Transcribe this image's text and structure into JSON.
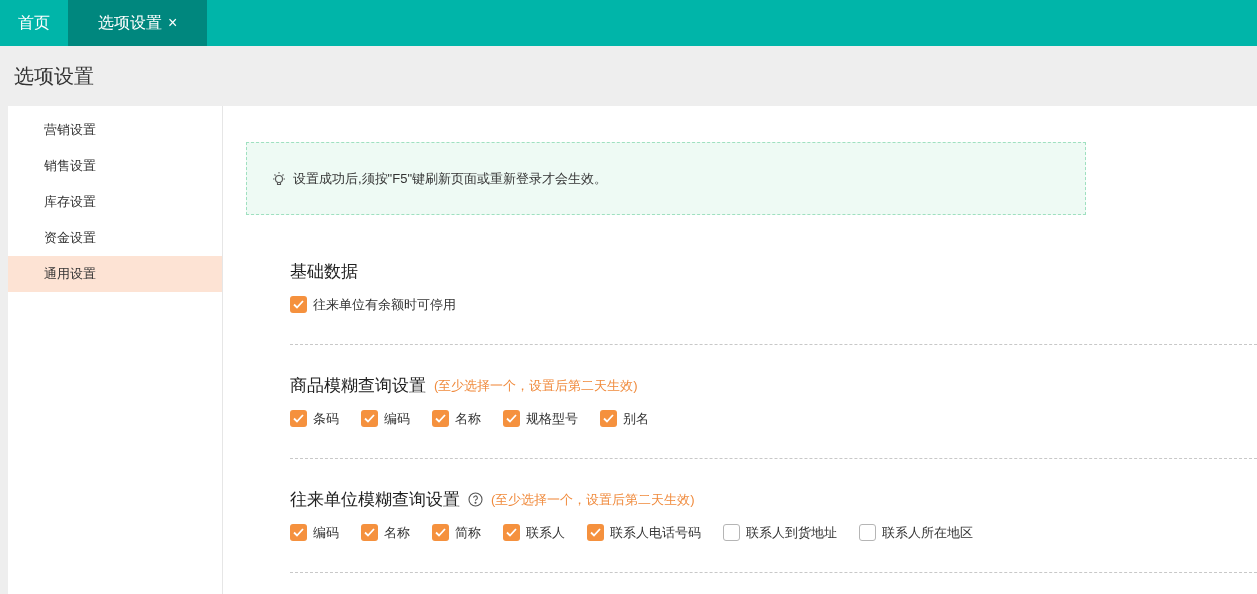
{
  "tabs": [
    {
      "label": "首页",
      "selected": false
    },
    {
      "label": "选项设置",
      "selected": true,
      "close_glyph": "×"
    }
  ],
  "page_title": "选项设置",
  "sidebar": {
    "items": [
      {
        "label": "营销设置",
        "selected": false
      },
      {
        "label": "销售设置",
        "selected": false
      },
      {
        "label": "库存设置",
        "selected": false
      },
      {
        "label": "资金设置",
        "selected": false
      },
      {
        "label": "通用设置",
        "selected": true
      }
    ]
  },
  "notice": "设置成功后,须按\"F5\"键刷新页面或重新登录才会生效。",
  "sections": [
    {
      "title": "基础数据",
      "options": [
        {
          "label": "往来单位有余额时可停用",
          "checked": true
        }
      ]
    },
    {
      "title": "商品模糊查询设置",
      "hint": "(至少选择一个，设置后第二天生效)",
      "options": [
        {
          "label": "条码",
          "checked": true
        },
        {
          "label": "编码",
          "checked": true
        },
        {
          "label": "名称",
          "checked": true
        },
        {
          "label": "规格型号",
          "checked": true
        },
        {
          "label": "别名",
          "checked": true
        }
      ]
    },
    {
      "title": "往来单位模糊查询设置",
      "help": true,
      "hint": "(至少选择一个，设置后第二天生效)",
      "options": [
        {
          "label": "编码",
          "checked": true
        },
        {
          "label": "名称",
          "checked": true
        },
        {
          "label": "简称",
          "checked": true
        },
        {
          "label": "联系人",
          "checked": true
        },
        {
          "label": "联系人电话号码",
          "checked": true
        },
        {
          "label": "联系人到货地址",
          "checked": false
        },
        {
          "label": "联系人所在地区",
          "checked": false
        }
      ]
    }
  ]
}
